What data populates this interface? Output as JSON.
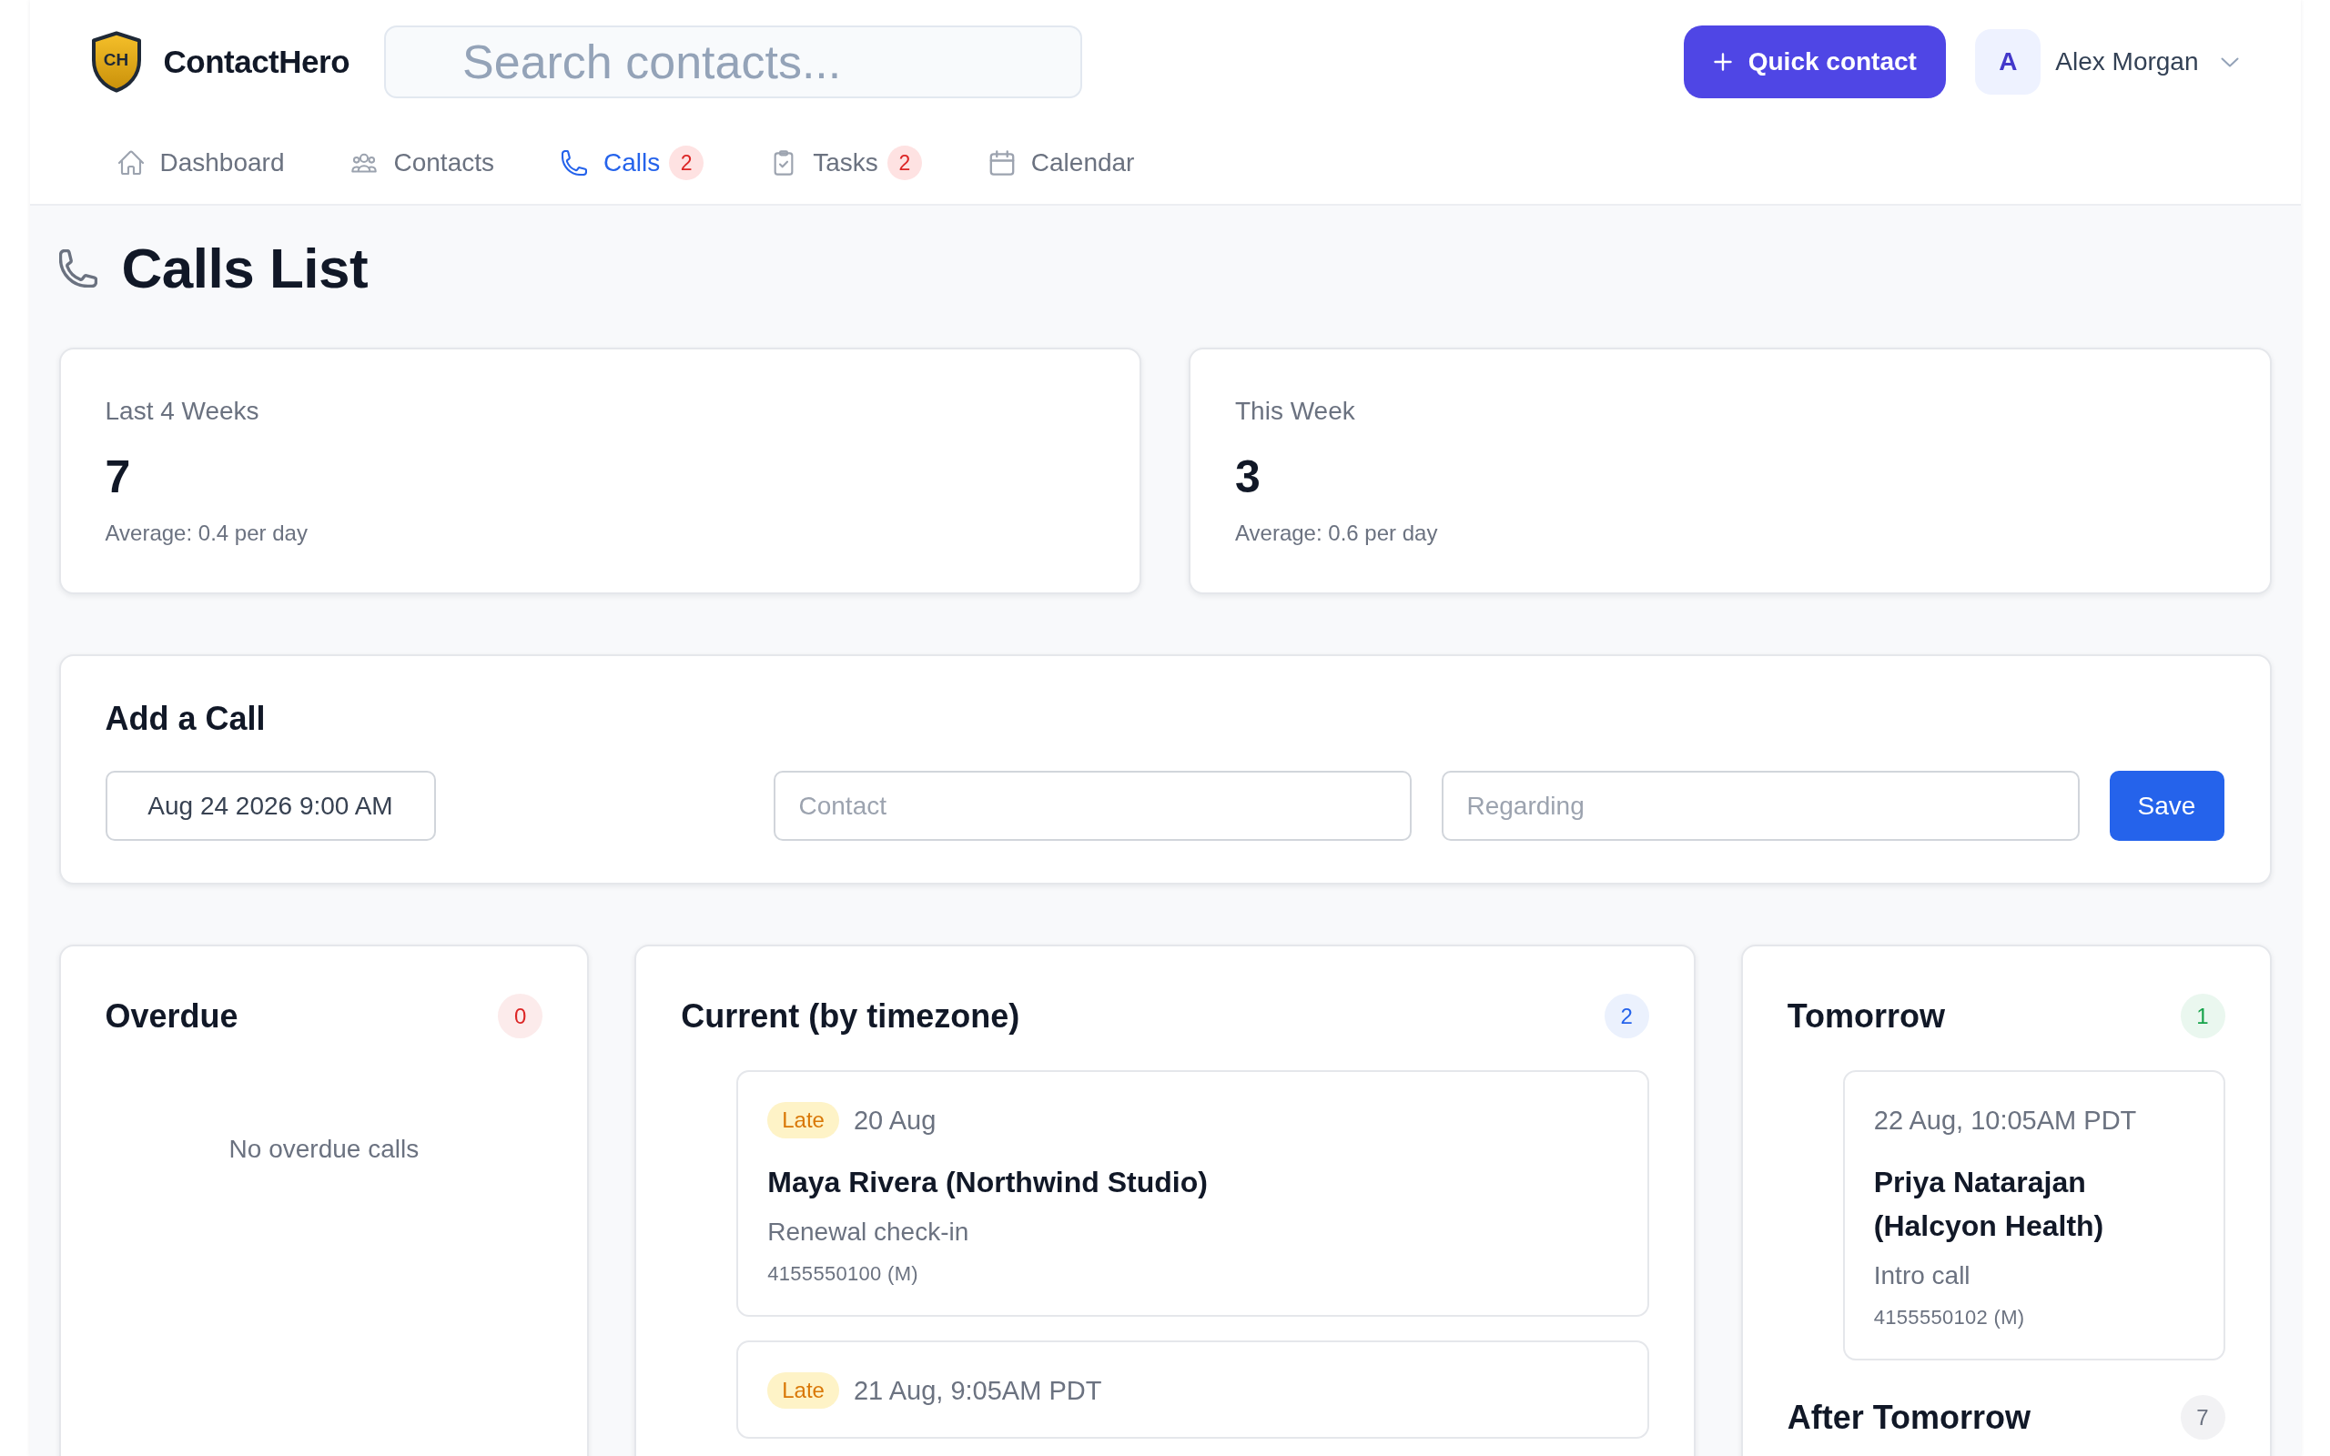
{
  "header": {
    "brand": {
      "monogram": "CH",
      "name": "ContactHero"
    },
    "search": {
      "placeholder": "Search contacts..."
    },
    "quick_button": {
      "label": "Quick contact"
    },
    "user": {
      "initial": "A",
      "name": "Alex Morgan"
    }
  },
  "nav": [
    {
      "label": "Dashboard",
      "selected": false
    },
    {
      "label": "Contacts",
      "selected": false
    },
    {
      "label": "Calls",
      "selected": true,
      "badge": "2"
    },
    {
      "label": "Tasks",
      "selected": false,
      "badge": "2"
    },
    {
      "label": "Calendar",
      "selected": false
    }
  ],
  "page": {
    "title": "Calls List"
  },
  "stats": [
    {
      "label": "Last 4 Weeks",
      "value": "7",
      "note": "Average: 0.4 per day"
    },
    {
      "label": "This Week",
      "value": "3",
      "note": "Average: 0.6 per day"
    }
  ],
  "add_call": {
    "title": "Add a Call",
    "fields": [
      {
        "kind": "date",
        "value": "Aug 24 2026 9:00 AM"
      },
      {
        "kind": "text",
        "placeholder": "Contact"
      },
      {
        "kind": "text",
        "placeholder": "Regarding"
      }
    ],
    "save_button": "Save"
  },
  "panels": [
    {
      "sections": [
        {
          "title": "Overdue",
          "count": "0",
          "color": "#dc2626",
          "empty_text": "No overdue calls"
        }
      ]
    },
    {
      "sections": [
        {
          "title": "Current (by timezone)",
          "count": "2",
          "color": "#2563eb",
          "calls": [
            {
              "tag": "Late",
              "when": "20 Aug",
              "name": "Maya Rivera (Northwind Studio)",
              "subject": "Renewal check-in",
              "phone": "4155550100 (M)"
            },
            {
              "tag": "Late",
              "when": "21 Aug, 9:05AM PDT"
            }
          ]
        }
      ]
    },
    {
      "sections": [
        {
          "title": "Tomorrow",
          "count": "1",
          "color": "#16a34a",
          "calls": [
            {
              "when": "22 Aug, 10:05AM PDT",
              "name": "Priya Natarajan (Halcyon Health)",
              "subject": "Intro call",
              "phone": "4155550102 (M)"
            }
          ]
        },
        {
          "title": "After Tomorrow",
          "count": "7",
          "color": "#6b7280"
        }
      ]
    }
  ]
}
